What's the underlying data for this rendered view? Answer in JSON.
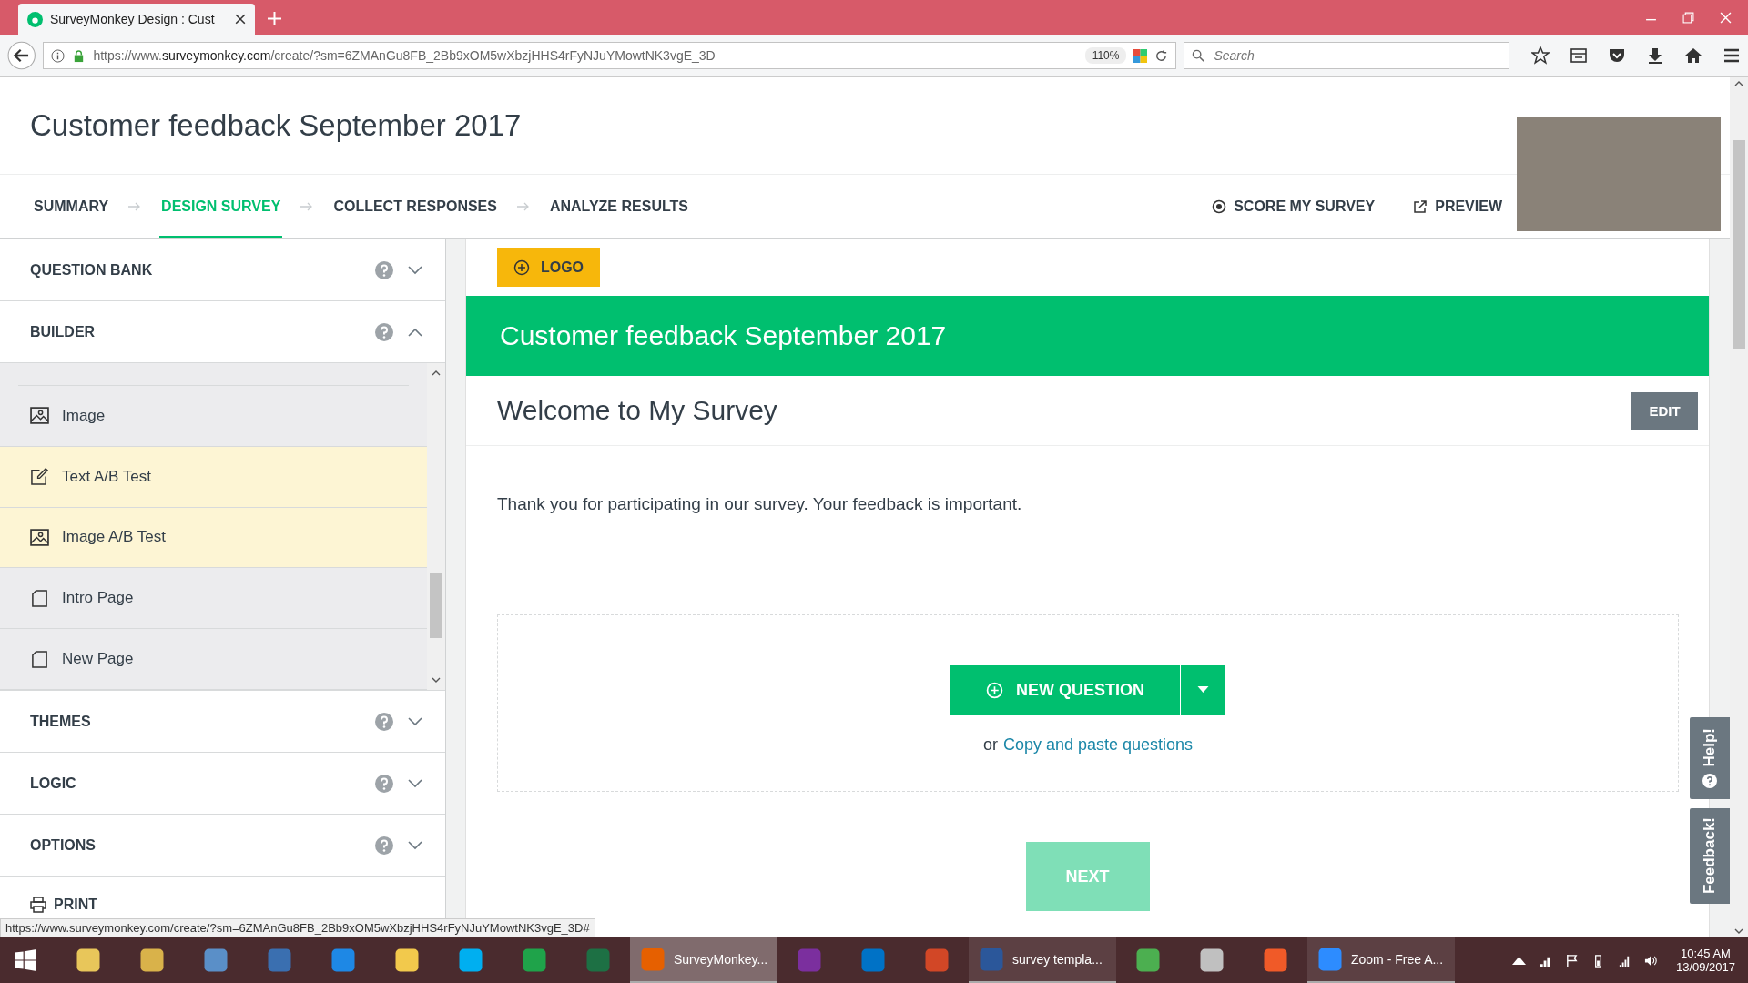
{
  "browser": {
    "tab_title": "SurveyMonkey Design : Cust",
    "url_prefix": "https://www.",
    "url_domain": "surveymonkey.com",
    "url_path": "/create/?sm=6ZMAnGu8FB_2Bb9xOM5wXbzjHHS4rFyNJuYMowtNK3vgE_3D",
    "zoom": "110%",
    "search_placeholder": "Search"
  },
  "header": {
    "title": "Customer feedback September 2017"
  },
  "nav": [
    {
      "label": "SUMMARY",
      "selected": false
    },
    {
      "label": "DESIGN SURVEY",
      "selected": true
    },
    {
      "label": "COLLECT RESPONSES",
      "selected": false
    },
    {
      "label": "ANALYZE RESULTS",
      "selected": false
    }
  ],
  "nav_actions": [
    {
      "label": "SCORE MY SURVEY",
      "kind": "score"
    },
    {
      "label": "PREVIEW",
      "kind": "preview"
    }
  ],
  "sidebar": {
    "sections_top": [
      {
        "label": "QUESTION BANK",
        "expanded": false
      },
      {
        "label": "BUILDER",
        "expanded": true
      }
    ],
    "builder_items": [
      {
        "label": "Image",
        "kind": "image",
        "highlighted": false
      },
      {
        "label": "Text A/B Test",
        "kind": "edit",
        "highlighted": true
      },
      {
        "label": "Image A/B Test",
        "kind": "image",
        "highlighted": true
      },
      {
        "label": "Intro Page",
        "kind": "page",
        "highlighted": false
      },
      {
        "label": "New Page",
        "kind": "page",
        "highlighted": false
      }
    ],
    "sections_bottom": [
      {
        "label": "THEMES",
        "expanded": false
      },
      {
        "label": "LOGIC",
        "expanded": false
      },
      {
        "label": "OPTIONS",
        "expanded": false
      }
    ],
    "print": "PRINT"
  },
  "survey": {
    "logo_button": "LOGO",
    "title": "Customer feedback September 2017",
    "page_title": "Welcome to My Survey",
    "edit_button": "EDIT",
    "intro": "Thank you for participating in our survey. Your feedback is important.",
    "new_question": "NEW QUESTION",
    "copy_prefix": "or",
    "copy_link": "Copy and paste questions",
    "next_button": "NEXT"
  },
  "side_tabs": {
    "help": "Help!",
    "feedback": "Feedback!"
  },
  "status_url": "https://www.surveymonkey.com/create/?sm=6ZMAnGu8FB_2Bb9xOM5wXbzjHHS4rFyNJuYMowtNK3vgE_3D#",
  "taskbar": {
    "items": [
      {
        "kind": "files",
        "selected": false
      },
      {
        "kind": "library",
        "selected": false
      },
      {
        "kind": "panel",
        "selected": false
      },
      {
        "kind": "monitor",
        "selected": false
      },
      {
        "kind": "globe",
        "selected": false
      },
      {
        "kind": "folder",
        "selected": false
      },
      {
        "kind": "chat",
        "selected": false
      },
      {
        "kind": "store",
        "selected": false
      },
      {
        "kind": "sheet",
        "selected": false
      },
      {
        "kind": "fox",
        "label": "SurveyMonkey...",
        "selected": true
      },
      {
        "kind": "notes",
        "selected": false
      },
      {
        "kind": "mail",
        "selected": false
      },
      {
        "kind": "slides",
        "selected": false
      },
      {
        "kind": "doc",
        "label": "survey templa...",
        "selected": false
      },
      {
        "kind": "browser",
        "selected": false
      },
      {
        "kind": "scissors",
        "selected": false
      },
      {
        "kind": "camera",
        "selected": false
      },
      {
        "kind": "video",
        "label": "Zoom - Free A...",
        "selected": false
      }
    ],
    "time": "10:45 AM",
    "date": "13/09/2017"
  }
}
